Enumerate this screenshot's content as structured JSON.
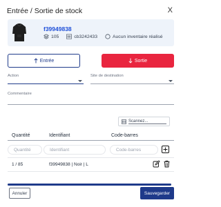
{
  "dialog": {
    "title": "Entrée / Sortie de stock",
    "close_label": "X"
  },
  "product": {
    "sku": "f39949838",
    "stock_count": "105",
    "barcode": "cb3242433",
    "inventory_status": "Aucun inventaire réalisé",
    "icons": {
      "image": "hoodie-image",
      "stock": "stack-icon",
      "barcode": "barcode-icon",
      "inventory": "circle-icon"
    }
  },
  "actions": {
    "entry_label": "Entrée",
    "exit_label": "Sortie",
    "entry_icon": "arrow-up-icon",
    "exit_icon": "arrow-down-icon"
  },
  "form": {
    "action_label": "Action",
    "destination_label": "Site de destination",
    "comment_label": "Commentaire",
    "scan_label": "Scannez..."
  },
  "table": {
    "headers": [
      "Quantité",
      "Identifiant",
      "Code-barres"
    ],
    "input_placeholders": {
      "quantity": "Quantité",
      "identifier": "Identifiant",
      "barcode": "Code-barres"
    },
    "rows": [
      {
        "quantity": "1 / 85",
        "identifier": "f39949838 | Noir | L"
      }
    ]
  },
  "progress": {
    "value": 1.0
  },
  "footer": {
    "cancel_label": "Annuler",
    "save_label": "Sauvegarder"
  },
  "colors": {
    "primary": "#1e3a8a",
    "danger": "#e9253f",
    "card_bg": "#eef3fa",
    "link": "#1d4ed8"
  }
}
